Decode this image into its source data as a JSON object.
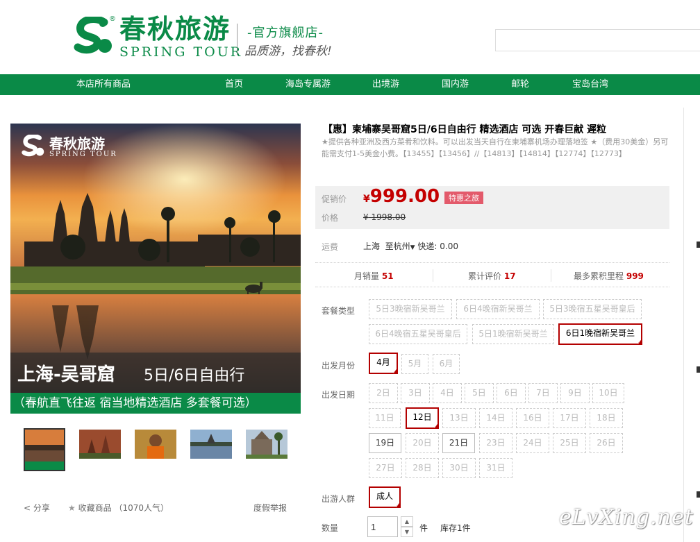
{
  "header": {
    "brand_cn": "春秋旅游",
    "brand_en": "SPRING TOUR",
    "reg_mark": "®",
    "flagship": "-官方旗舰店-",
    "slogan": "品质游，找春秋!",
    "brand_color": "#0a8a47",
    "search": {
      "placeholder": ""
    }
  },
  "nav": {
    "items": [
      "本店所有商品",
      "首页",
      "海岛专属游",
      "出境游",
      "国内游",
      "邮轮",
      "宝岛台湾"
    ]
  },
  "gallery": {
    "overlay_logo_cn": "春秋旅游",
    "overlay_logo_en": "SPRING TOUR",
    "banner_title": "上海-吴哥窟",
    "banner_sub": "5日/6日自由行",
    "banner_caption": "（春航直飞往返 宿当地精选酒店 多套餐可选）",
    "thumbs": [
      "sunset-temple",
      "red-temple",
      "monk",
      "reflection-temple",
      "stone-gate"
    ],
    "share_label": "分享",
    "fav_label": "收藏商品",
    "fav_count": "（1070人气）",
    "report_label": "度假举报"
  },
  "product": {
    "title": "【惠】柬埔寨吴哥窟5日/6日自由行 精选酒店 可选 开春巨献 遲粒",
    "subtitle": "★提供各种亚洲及西方菜肴和饮料。可以出发当天自行在柬埔寨机场办理落地签 ★（费用30美金）另可能需支付1-5美金小费。【13455】【13456】//【14813】【14814】【12774】【12773】",
    "promo_label": "促销价",
    "currency": "¥",
    "promo_price": "999.00",
    "promo_tag": "特惠之旅",
    "price_label": "价格",
    "orig_price": "1998.00",
    "ship_label": "运费",
    "ship_from": "上海",
    "ship_to": "至杭州",
    "ship_method": "快递: 0.00",
    "stats": [
      {
        "label": "月销量",
        "value": "51"
      },
      {
        "label": "累计评价",
        "value": "17"
      },
      {
        "label": "最多累积里程",
        "value": "999"
      }
    ]
  },
  "options": {
    "package_label": "套餐类型",
    "packages": [
      "5日3晚宿新吴哥兰",
      "6日4晚宿新吴哥兰",
      "5日3晚宿五星吴哥皇后",
      "6日4晚宿五星吴哥皇后",
      "5日1晚宿新吴哥兰",
      "6日1晚宿新吴哥兰"
    ],
    "month_label": "出发月份",
    "months": [
      "4月",
      "5月",
      "6月"
    ],
    "date_label": "出发日期",
    "dates": [
      "2日",
      "3日",
      "4日",
      "5日",
      "6日",
      "7日",
      "9日",
      "10日",
      "11日",
      "12日",
      "13日",
      "14日",
      "16日",
      "17日",
      "18日",
      "19日",
      "20日",
      "21日",
      "23日",
      "24日",
      "25日",
      "26日",
      "27日",
      "28日",
      "30日",
      "31日"
    ],
    "group_label": "出游人群",
    "group": "成人",
    "qty_label": "数量",
    "qty_value": "1",
    "qty_unit": "件",
    "stock": "库存1件",
    "selected_color": "#b30000"
  },
  "watermark": "eLvXing.net"
}
